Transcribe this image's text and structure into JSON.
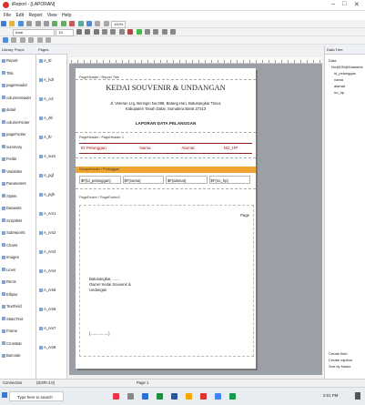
{
  "window": {
    "title": "iReport - [LAPORAN]",
    "controls": [
      "–",
      "□",
      "✕"
    ]
  },
  "menu": [
    "File",
    "Edit",
    "Report",
    "View",
    "Help"
  ],
  "toolbar2": {
    "font_combo": "Arial",
    "size_combo": "10"
  },
  "toolbar3": {
    "zoom_combo": "100%"
  },
  "left_tabs": [
    "Library",
    "Props",
    "Pages"
  ],
  "leftpane1_items": [
    "Report",
    "Title",
    "pageHeader",
    "columnHeader",
    "detail",
    "columnFooter",
    "pageFooter",
    "summary",
    "Fields",
    "Variables",
    "Parameters",
    "Styles",
    "Datasets",
    "Scriptlets",
    "Subreports",
    "Charts",
    "Images",
    "Lines",
    "Rects",
    "Ellipse",
    "TextField",
    "StaticText",
    "Frame",
    "Crosstab",
    "Barcode"
  ],
  "leftpane2_items": [
    "A_ttl",
    "A_hdr",
    "A_col",
    "A_dtl",
    "A_ftr",
    "A_sum",
    "A_pgf",
    "A_pgh",
    "A_nm1",
    "A_nm2",
    "A_nm3",
    "A_nm4",
    "A_nm5",
    "A_nm6",
    "A_nm7",
    "A_nm8"
  ],
  "report": {
    "band_title_label": "PageHeader / Report Title",
    "company": "KEDAI SOUVENIR & UNDANGAN",
    "address1": "Jl. Veteran Lrg. Beringin No.088, Batang Hari, Batusangkar Timur,",
    "address2": "Kabupaten Tanah Datar, Sumatera Barat 27213",
    "report_title": "LAPORAN DATA PELANGGAN",
    "band_col_label": "PageHeader / PageHeader 1",
    "headers": [
      "ID Pelanggan",
      "Nama",
      "Alamat",
      "NO_HP"
    ],
    "band_group_label": "GroupHeader / Pelanggan",
    "detail": [
      "$F{id_pelanggan}",
      "$F{nama}",
      "$F{alamat}",
      "$F{no_hp}"
    ],
    "band_footer_label": "PageFooter / PageFooter1",
    "page_field": "Page",
    "sig1": "Batusangkar, .......",
    "sig2": "Owner Kedai Souvenir &",
    "sig3": "Undangan",
    "sig_line": "(.................)"
  },
  "rightpane": {
    "title": "Data Tree",
    "items": [
      "Data",
      "No@DB@Datasets",
      "id_pelanggan",
      "nama",
      "alamat",
      "no_hp"
    ],
    "bottom": [
      "Create field",
      "Create caption",
      "Sort by Name"
    ]
  },
  "status": {
    "left": "Connection",
    "mid": "(SORI 4.0)",
    "page": "Page 1"
  },
  "taskbar": {
    "search_placeholder": "Type here to search",
    "clock": "2:01 PM"
  }
}
